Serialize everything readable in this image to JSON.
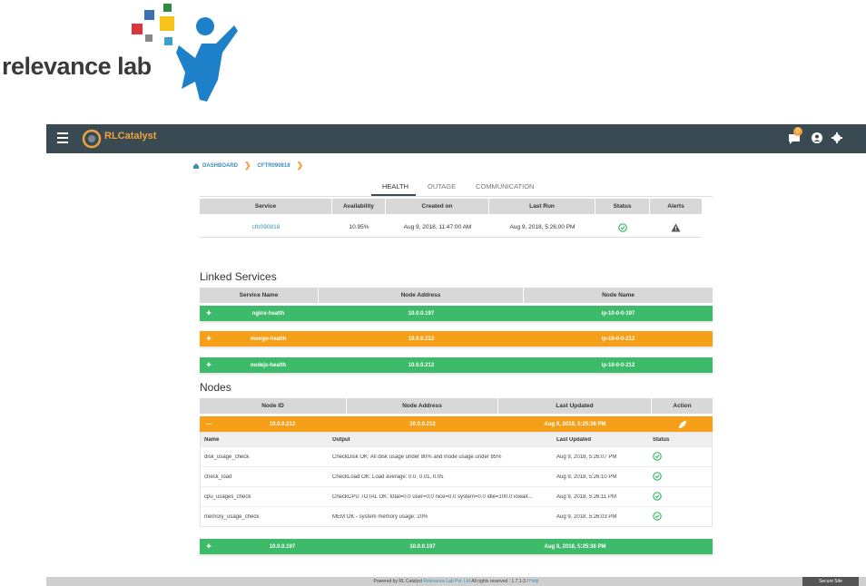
{
  "logo": {
    "text": "relevance lab"
  },
  "topbar": {
    "app_name": "RLCatalyst",
    "notification_count": "0"
  },
  "breadcrumb": [
    "DASHBOARD",
    "CFTR090818"
  ],
  "tabs": [
    "HEALTH",
    "OUTAGE",
    "COMMUNICATION"
  ],
  "service_table": {
    "headers": [
      "Service",
      "Availability",
      "Created on",
      "Last Run",
      "Status",
      "Alerts"
    ],
    "row": {
      "service": "cftr090818",
      "availability": "10.95%",
      "created_on": "Aug 9, 2018, 11:47:00 AM",
      "last_run": "Aug 9, 2018, 5:26:00 PM"
    }
  },
  "linked_services": {
    "title": "Linked Services",
    "headers": [
      "Service Name",
      "Node Address",
      "Node Name"
    ],
    "rows": [
      {
        "name": "nginx-health",
        "address": "10.0.0.197",
        "node": "ip-10-0-0-197",
        "color": "#3dba6a"
      },
      {
        "name": "mongo-health",
        "address": "10.0.0.212",
        "node": "ip-10-0-0-212",
        "color": "#f6a01a"
      },
      {
        "name": "nodejs-health",
        "address": "10.0.0.212",
        "node": "ip-10-0-0-212",
        "color": "#3dba6a"
      }
    ]
  },
  "nodes": {
    "title": "Nodes",
    "headers": [
      "Node ID",
      "Node Address",
      "Last Updated",
      "Action"
    ],
    "expanded": {
      "id": "10.0.0.212",
      "address": "10.0.0.212",
      "updated": "Aug 9, 2018, 5:25:36 PM",
      "sub_headers": [
        "Name",
        "Output",
        "Last Updated",
        "Status"
      ],
      "checks": [
        {
          "name": "disk_usage_check",
          "output": "CheckDisk OK: All disk usage under 80% and inode usage under 85%",
          "updated": "Aug 9, 2018, 5:26:07 PM"
        },
        {
          "name": "check_load",
          "output": "CheckLoad OK: Load average: 0.0, 0.01, 0.05",
          "updated": "Aug 9, 2018, 5:26:10 PM"
        },
        {
          "name": "cpu_usages_check",
          "output": "CheckCPU TOTAL OK: total=0.0 user=0.0 nice=0.0 system=0.0 idle=100.0 iowait...",
          "updated": "Aug 9, 2018, 5:26:11 PM"
        },
        {
          "name": "memory_usage_check",
          "output": "MEM OK - system memory usage: 20%",
          "updated": "Aug 9, 2018, 5:26:03 PM"
        }
      ]
    },
    "collapsed": {
      "id": "10.0.0.197",
      "address": "10.0.0.197",
      "updated": "Aug 9, 2018, 5:25:36 PM"
    }
  },
  "footer": {
    "prefix": "Powered by RL Catalyst",
    "company": "Relevance Lab Pvt. Ltd",
    "suffix": "All rights reserved : 1.7.1-3 /",
    "help": "Help",
    "badge": "Secure Site"
  },
  "colors": {
    "green": "#3dba6a",
    "orange": "#f6a01a",
    "topbar": "#3a4a53"
  }
}
